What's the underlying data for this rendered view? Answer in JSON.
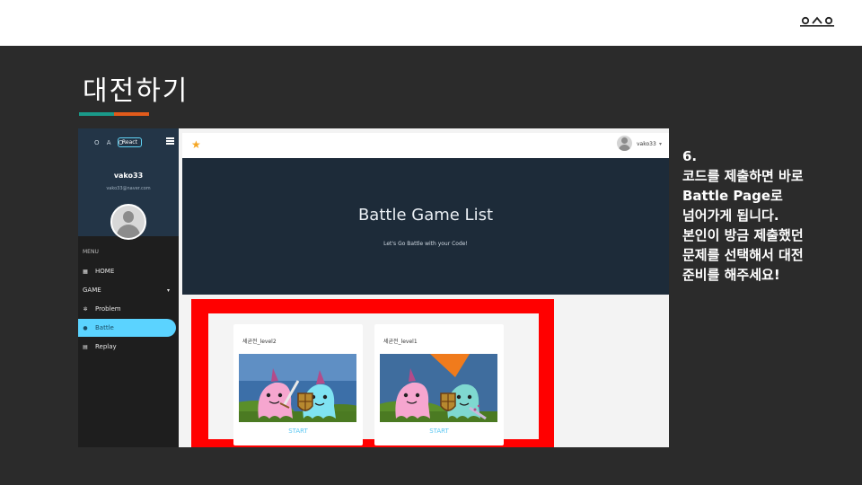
{
  "slide": {
    "title": "대전하기",
    "brand_logo_icon": "oao-logo-icon",
    "accent_colors": [
      "#1a9a8a",
      "#e25b1b"
    ]
  },
  "app": {
    "sidebar": {
      "logo_text": "O A O",
      "react_chip": "React",
      "user_name": "vako33",
      "user_email": "vako33@naver.com",
      "menu_heading": "MENU",
      "items": [
        {
          "label": "HOME",
          "icon": "home-icon"
        },
        {
          "label": "GAME",
          "icon": "chevron-down-icon"
        },
        {
          "label": "Problem",
          "icon": "gear-icon"
        },
        {
          "label": "Battle",
          "icon": "user-icon",
          "active": true
        },
        {
          "label": "Replay",
          "icon": "document-icon"
        }
      ],
      "active_color": "#5bd3ff"
    },
    "appbar": {
      "user_name": "vako33"
    },
    "hero": {
      "title": "Battle Game List",
      "subtitle": "Let's Go Battle with your Code!"
    },
    "cards": [
      {
        "title": "세균전_level2",
        "action": "START"
      },
      {
        "title": "세균전_level1",
        "action": "START"
      }
    ],
    "highlight_color": "#ff0000"
  },
  "description": {
    "lines": [
      "6.",
      "코드를 제출하면 바로",
      "Battle Page로",
      "넘어가게 됩니다.",
      "본인이 방금 제출했던",
      "문제를 선택해서 대전",
      "준비를 해주세요!"
    ]
  }
}
